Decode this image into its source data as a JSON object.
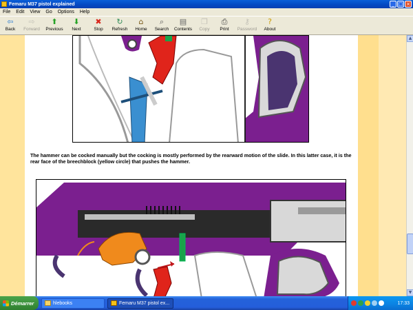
{
  "window": {
    "title": "Femaru M37 pistol explained",
    "controls": [
      "_",
      "□",
      "×"
    ]
  },
  "menu": [
    "File",
    "Edit",
    "View",
    "Go",
    "Options",
    "Help"
  ],
  "toolbar": [
    {
      "label": "Back",
      "icon": "back-arrow-icon",
      "glyph": "⇦",
      "color": "#2f7fd4",
      "enabled": true
    },
    {
      "label": "Forward",
      "icon": "forward-arrow-icon",
      "glyph": "⇨",
      "color": "#888888",
      "enabled": false
    },
    {
      "label": "Previous",
      "icon": "up-arrow-icon",
      "glyph": "⬆",
      "color": "#27a327",
      "enabled": true
    },
    {
      "label": "Next",
      "icon": "down-arrow-icon",
      "glyph": "⬇",
      "color": "#27a327",
      "enabled": true
    },
    {
      "label": "Stop",
      "icon": "stop-icon",
      "glyph": "✖",
      "color": "#d9261c",
      "enabled": true
    },
    {
      "label": "Refresh",
      "icon": "refresh-icon",
      "glyph": "↻",
      "color": "#2e8b57",
      "enabled": true
    },
    {
      "label": "Home",
      "icon": "home-icon",
      "glyph": "⌂",
      "color": "#7a5a1a",
      "enabled": true
    },
    {
      "label": "Search",
      "icon": "search-icon",
      "glyph": "⌕",
      "color": "#555555",
      "enabled": true
    },
    {
      "label": "Contents",
      "icon": "contents-icon",
      "glyph": "▤",
      "color": "#666666",
      "enabled": true
    },
    {
      "label": "Copy",
      "icon": "copy-icon",
      "glyph": "❐",
      "color": "#888888",
      "enabled": false
    },
    {
      "label": "Print",
      "icon": "print-icon",
      "glyph": "⎙",
      "color": "#444444",
      "enabled": true
    },
    {
      "label": "Password",
      "icon": "key-icon",
      "glyph": "⚷",
      "color": "#888888",
      "enabled": false
    },
    {
      "label": "About",
      "icon": "about-icon",
      "glyph": "?",
      "color": "#c99a00",
      "enabled": true
    }
  ],
  "page": {
    "paragraph": "The hammer can be cocked manually but the cocking is mostly performed by the rearward motion of the slide. In this latter case, it is the rear face of the breechblock (yellow circle) that pushes the hammer."
  },
  "colors": {
    "gun_purple": "#7b1f8f",
    "hammer_red": "#e0241b",
    "hammer_orange": "#f08a1c",
    "spring_blue": "#3a8fd0",
    "dark_purple": "#4a3470",
    "page_gutter": "#ffe49c"
  },
  "taskbar": {
    "start_label": "Démarrer",
    "tasks": [
      {
        "label": "hlebooks",
        "icon": "folder-icon",
        "active": false
      },
      {
        "label": "Femaru M37 pistol ex...",
        "icon": "ebook-icon",
        "active": true
      }
    ],
    "clock": "17:33"
  }
}
